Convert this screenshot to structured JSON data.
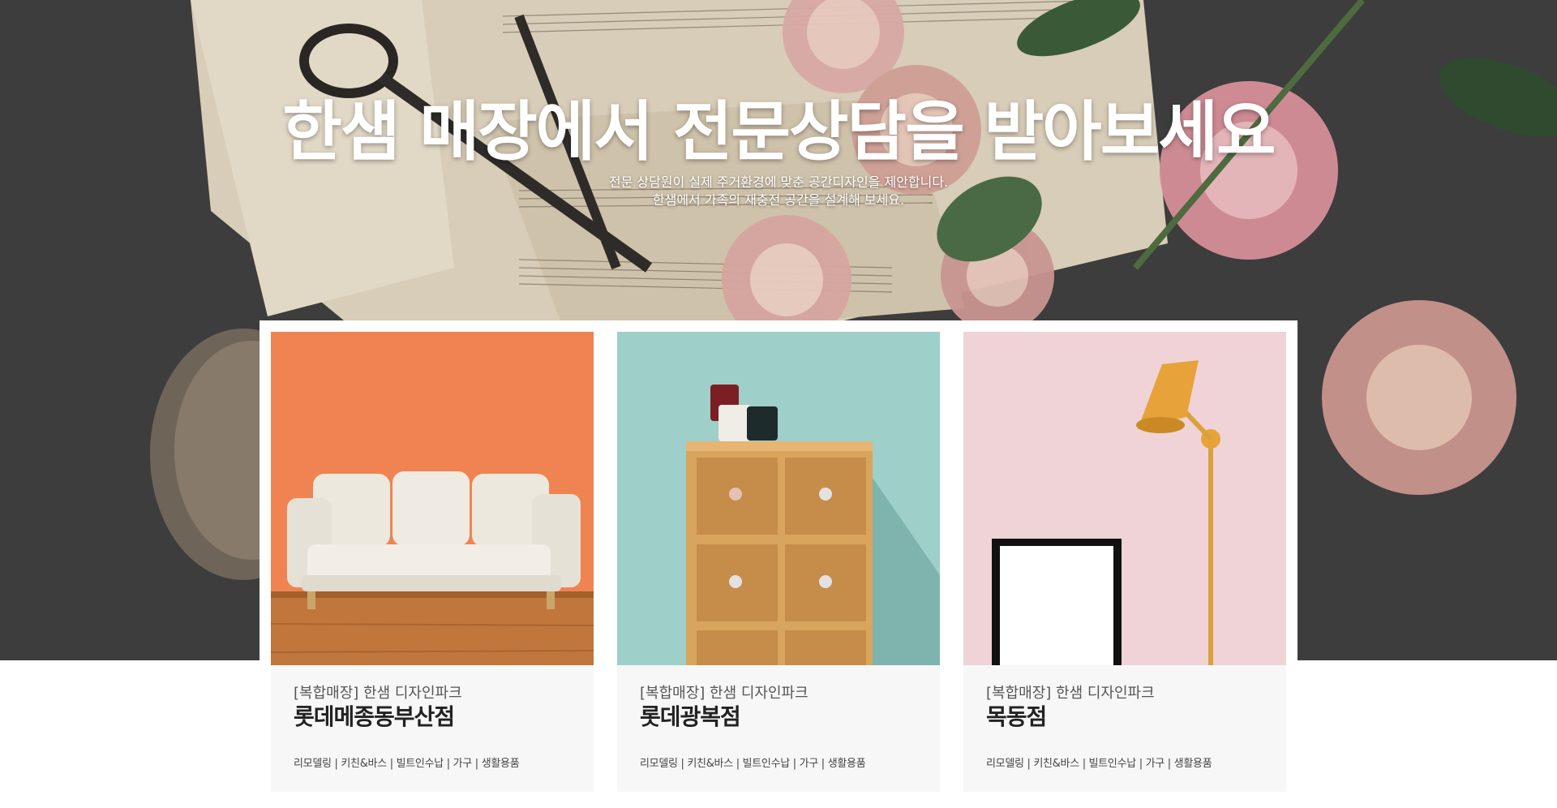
{
  "hero": {
    "title": "한샘 매장에서 전문상담을 받아보세요",
    "subtitle_line1": "전문 상담원이 실제 주거환경에 맞춘 공간디자인을 제안합니다.",
    "subtitle_line2": "한샘에서 가족의 재충전 공간을 설계해 보세요."
  },
  "stores": [
    {
      "category": "[복합매장] 한샘 디자인파크",
      "name": "롯데메종동부산점",
      "tags": "리모델링 | 키친&바스 | 빌트인수납 | 가구 | 생활용품",
      "image": "white-sofa-orange-wall"
    },
    {
      "category": "[복합매장] 한샘 디자인파크",
      "name": "롯데광복점",
      "tags": "리모델링 | 키친&바스 | 빌트인수납 | 가구 | 생활용품",
      "image": "wooden-drawer-cabinet-teal-wall"
    },
    {
      "category": "[복합매장] 한샘 디자인파크",
      "name": "목동점",
      "tags": "리모델링 | 키친&바스 | 빌트인수납 | 가구 | 생활용품",
      "image": "floor-lamp-frame-pink-wall"
    }
  ],
  "colors": {
    "hero_bg": "#3d3d3d",
    "card_bg": "#f7f7f7",
    "sofa_wall": "#ef8452",
    "cabinet_wall": "#9ecfc9",
    "lamp_wall": "#efd3d6",
    "lamp": "#e7a33a"
  }
}
